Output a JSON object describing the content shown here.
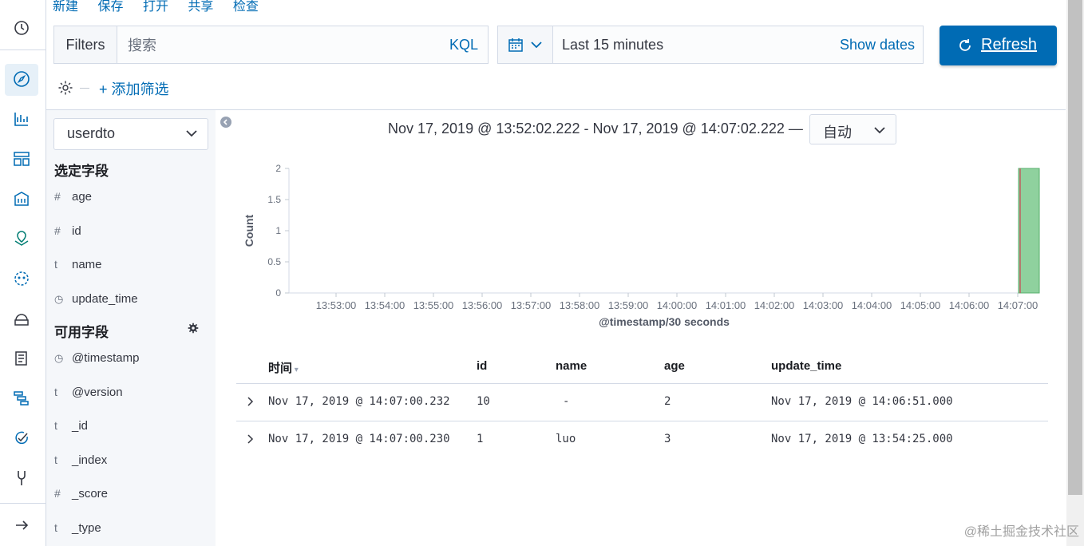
{
  "top_menu": [
    "新建",
    "保存",
    "打开",
    "共享",
    "检查"
  ],
  "query": {
    "filters_label": "Filters",
    "search_placeholder": "搜索",
    "language": "KQL"
  },
  "time": {
    "quick_label": "Last 15 minutes",
    "show_dates": "Show dates",
    "refresh": "Refresh"
  },
  "filter_row": {
    "add_filter": "+ 添加筛选"
  },
  "sidebar": {
    "index_pattern": "userdto",
    "selected_title": "选定字段",
    "selected_fields": [
      {
        "type": "#",
        "name": "age"
      },
      {
        "type": "#",
        "name": "id"
      },
      {
        "type": "t",
        "name": "name"
      },
      {
        "type": "clock",
        "name": "update_time"
      }
    ],
    "available_title": "可用字段",
    "available_fields": [
      {
        "type": "clock",
        "name": "@timestamp"
      },
      {
        "type": "t",
        "name": "@version"
      },
      {
        "type": "t",
        "name": "_id"
      },
      {
        "type": "t",
        "name": "_index"
      },
      {
        "type": "#",
        "name": "_score"
      },
      {
        "type": "t",
        "name": "_type"
      }
    ]
  },
  "histogram": {
    "range_text": "Nov 17, 2019 @ 13:52:02.222 - Nov 17, 2019 @ 14:07:02.222 —",
    "interval": "自动"
  },
  "chart_data": {
    "type": "bar",
    "ylabel": "Count",
    "xlabel": "@timestamp/30 seconds",
    "y_ticks": [
      "0",
      "0.5",
      "1",
      "1.5",
      "2"
    ],
    "ylim": [
      0,
      2
    ],
    "x_ticks": [
      "13:53:00",
      "13:54:00",
      "13:55:00",
      "13:56:00",
      "13:57:00",
      "13:58:00",
      "13:59:00",
      "14:00:00",
      "14:01:00",
      "14:02:00",
      "14:03:00",
      "14:04:00",
      "14:05:00",
      "14:06:00",
      "14:07:00"
    ],
    "bars": [
      {
        "x": "14:07:00",
        "value": 2
      }
    ],
    "bar_color": "#8fd19e"
  },
  "table": {
    "columns": [
      "时间",
      "id",
      "name",
      "age",
      "update_time"
    ],
    "rows": [
      {
        "time": "Nov 17, 2019 @ 14:07:00.232",
        "id": "10",
        "name": "-",
        "age": "2",
        "update_time": "Nov 17, 2019 @ 14:06:51.000"
      },
      {
        "time": "Nov 17, 2019 @ 14:07:00.230",
        "id": "1",
        "name": "luo",
        "age": "3",
        "update_time": "Nov 17, 2019 @ 13:54:25.000"
      }
    ]
  },
  "watermark": "@稀土掘金技术社区",
  "colors": {
    "accent": "#006bb4",
    "sidebar_bg": "#f5f7fa",
    "border": "#d3dae6"
  }
}
